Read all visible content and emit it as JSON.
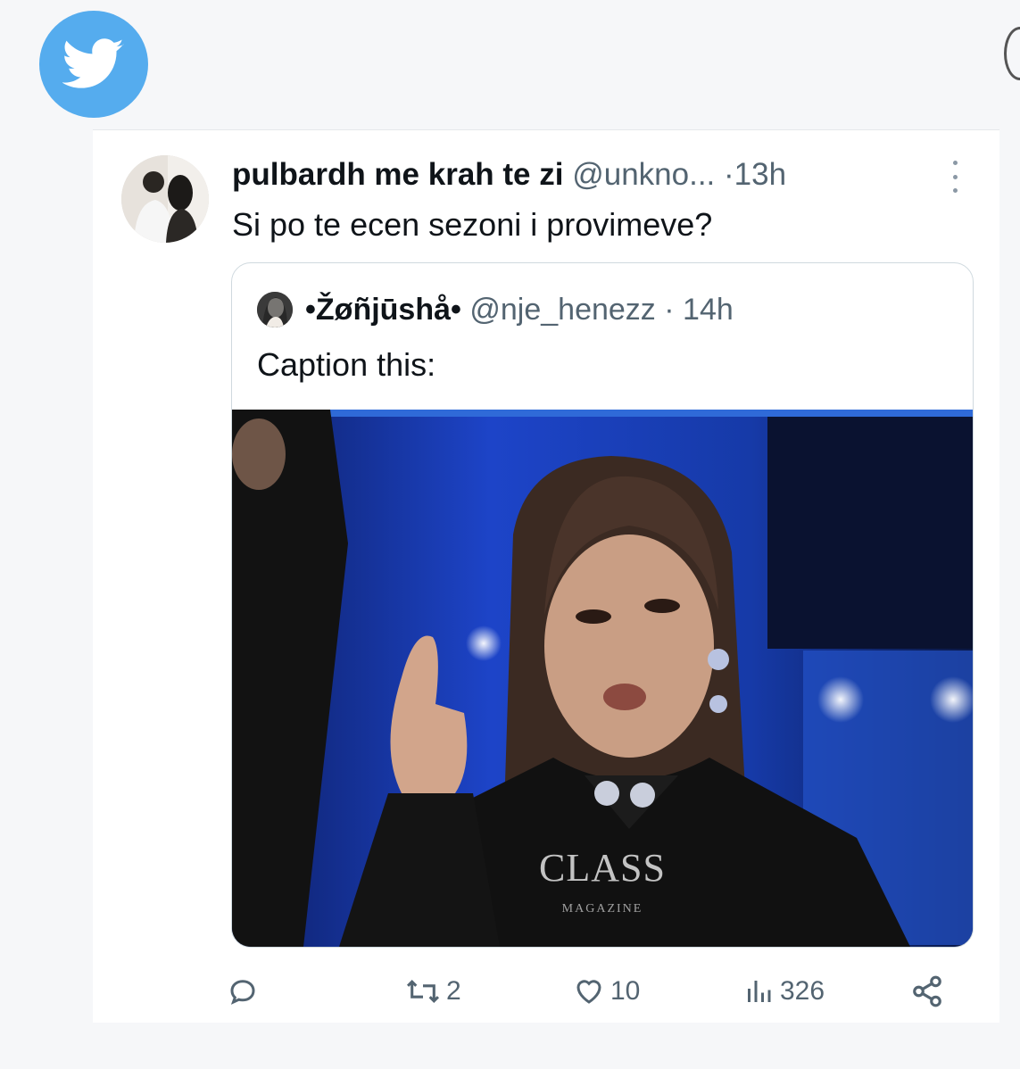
{
  "app": {
    "logo_icon": "twitter-bird-icon",
    "brand_color": "#55acee"
  },
  "tweet": {
    "display_name": "pulbardh me krah te zi",
    "handle": "@unkno...",
    "time_separator": "·",
    "time": "13h",
    "text": "Si po te ecen sezoni i provimeve?",
    "more_icon": "more-vertical-icon"
  },
  "quote": {
    "display_name": "•Žøñjūshå•",
    "handle": "@nje_henezz",
    "time_separator": "·",
    "time": "14h",
    "text": "Caption this:",
    "media": {
      "watermark_main": "CLASS",
      "watermark_sub": "MAGAZINE"
    }
  },
  "actions": {
    "reply": {
      "icon": "reply-icon",
      "count": ""
    },
    "retweet": {
      "icon": "retweet-icon",
      "count": "2"
    },
    "like": {
      "icon": "heart-icon",
      "count": "10"
    },
    "views": {
      "icon": "views-icon",
      "count": "326"
    },
    "share": {
      "icon": "share-icon"
    }
  },
  "colors": {
    "text_primary": "#0f1419",
    "text_secondary": "#536471",
    "border": "#cfd9de"
  }
}
